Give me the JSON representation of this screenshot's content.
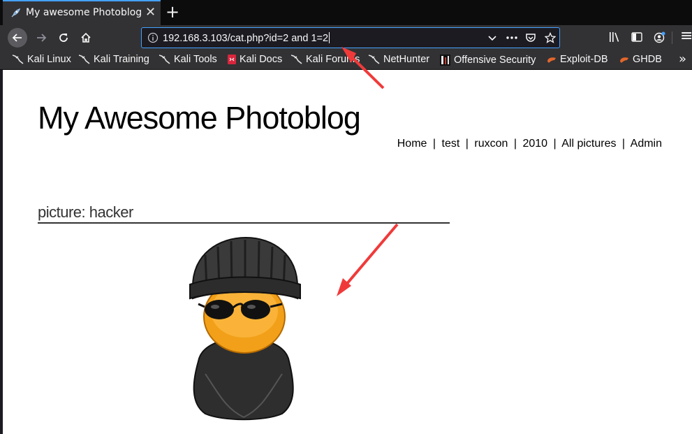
{
  "browser": {
    "tab_title": "My awesome Photoblog",
    "tab_close": "✕",
    "new_tab": "+",
    "url": "192.168.3.103/cat.php?id=2 and 1=2",
    "overflow": "»",
    "menu": "≡"
  },
  "bookmarks": [
    {
      "label": "Kali Linux",
      "icon": "kali-dragon-icon"
    },
    {
      "label": "Kali Training",
      "icon": "kali-dragon-icon"
    },
    {
      "label": "Kali Tools",
      "icon": "kali-dragon-icon"
    },
    {
      "label": "Kali Docs",
      "icon": "kali-docs-icon"
    },
    {
      "label": "Kali Forums",
      "icon": "kali-dragon-icon"
    },
    {
      "label": "NetHunter",
      "icon": "kali-dragon-icon"
    },
    {
      "label": "Offensive Security",
      "icon": "offsec-icon"
    },
    {
      "label": "Exploit-DB",
      "icon": "exploitdb-icon"
    },
    {
      "label": "GHDB",
      "icon": "exploitdb-icon"
    }
  ],
  "site": {
    "title": "My Awesome Photoblog",
    "nav": [
      "Home",
      "test",
      "ruxcon",
      "2010",
      "All pictures",
      "Admin"
    ],
    "nav_separator": "|",
    "picture_heading": "picture: hacker"
  },
  "colors": {
    "accent": "#45a1ff",
    "annotation_arrow": "#f03a3a"
  }
}
